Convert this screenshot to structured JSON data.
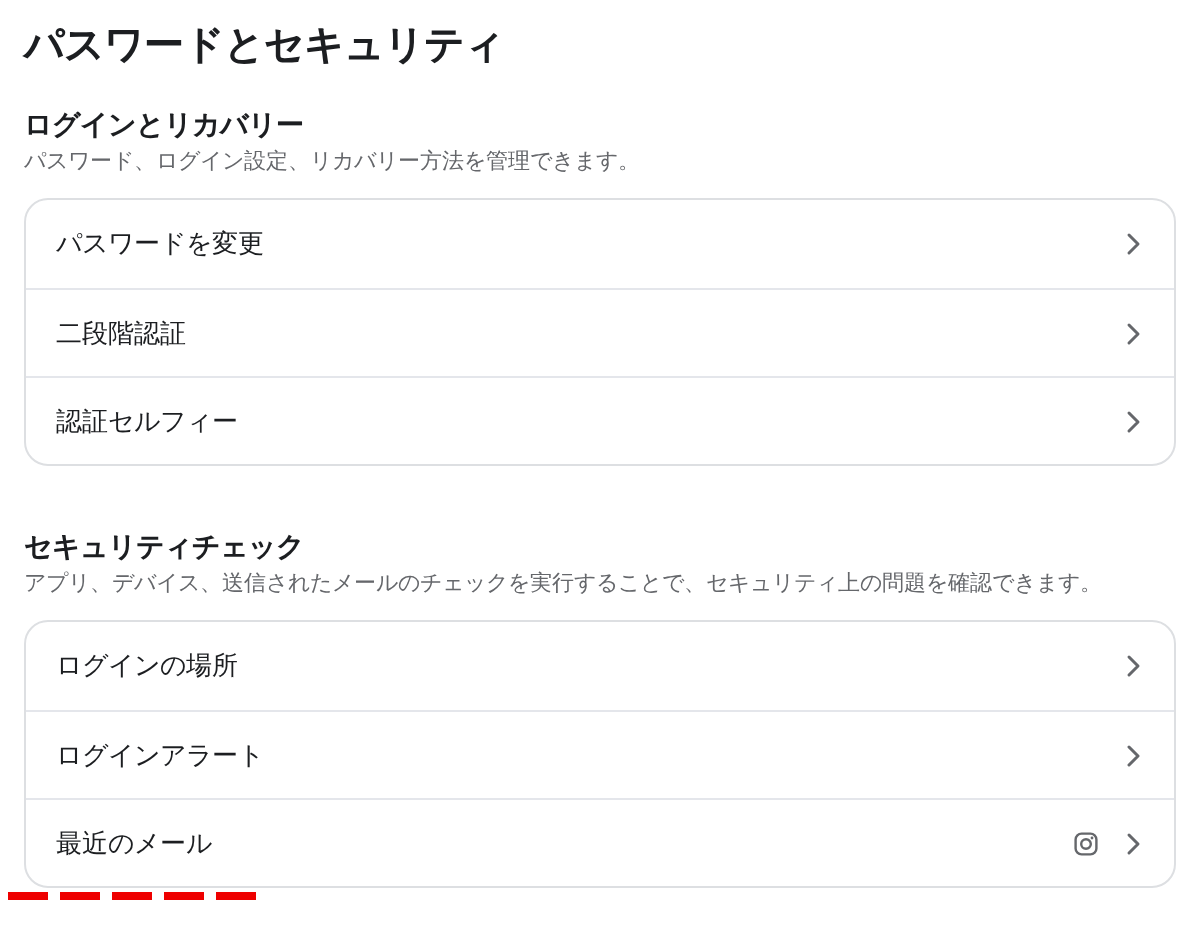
{
  "title": "パスワードとセキュリティ",
  "sections": [
    {
      "heading": "ログインとリカバリー",
      "description": "パスワード、ログイン設定、リカバリー方法を管理できます。",
      "items": [
        {
          "label": "パスワードを変更",
          "kind": "plain"
        },
        {
          "label": "二段階認証",
          "kind": "plain"
        },
        {
          "label": "認証セルフィー",
          "kind": "plain"
        }
      ]
    },
    {
      "heading": "セキュリティチェック",
      "description": "アプリ、デバイス、送信されたメールのチェックを実行することで、セキュリティ上の問題を確認できます。",
      "items": [
        {
          "label": "ログインの場所",
          "kind": "plain"
        },
        {
          "label": "ログインアラート",
          "kind": "plain"
        },
        {
          "label": "最近のメール",
          "kind": "instagram"
        }
      ]
    }
  ]
}
